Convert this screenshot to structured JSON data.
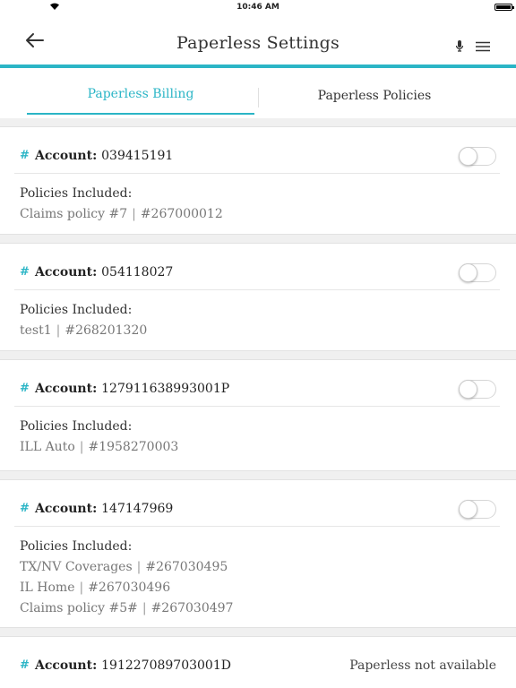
{
  "status_bar": {
    "time": "10:46 AM"
  },
  "header": {
    "title": "Paperless Settings"
  },
  "tabs": [
    {
      "label": "Paperless Billing",
      "active": true
    },
    {
      "label": "Paperless Policies",
      "active": false
    }
  ],
  "account_prefix": "Account:",
  "policies_label": "Policies Included:",
  "accounts": [
    {
      "number": "039415191",
      "paperless_enabled": false,
      "policies": [
        {
          "name": "Claims policy #7",
          "id": "#267000012"
        }
      ]
    },
    {
      "number": "054118027",
      "paperless_enabled": false,
      "policies": [
        {
          "name": "test1",
          "id": "#268201320"
        }
      ]
    },
    {
      "number": "127911638993001P",
      "paperless_enabled": false,
      "policies": [
        {
          "name": "ILL Auto",
          "id": "#1958270003"
        }
      ]
    },
    {
      "number": "147147969",
      "paperless_enabled": false,
      "policies": [
        {
          "name": "TX/NV Coverages",
          "id": "#267030495"
        },
        {
          "name": "IL Home",
          "id": "#267030496"
        },
        {
          "name": "Claims policy #5#",
          "id": "#267030497"
        }
      ]
    },
    {
      "number": "191227089703001D",
      "status": "Paperless not available"
    }
  ],
  "colors": {
    "accent": "#2bb5c6"
  }
}
